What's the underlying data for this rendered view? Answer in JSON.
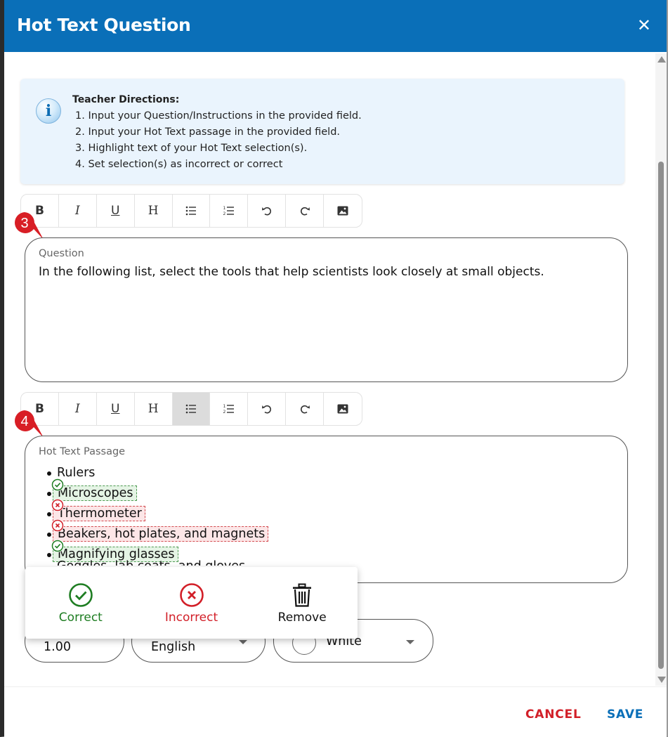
{
  "dialog": {
    "title": "Hot Text Question",
    "close_glyph": "✕"
  },
  "directions": {
    "title": "Teacher Directions:",
    "items": [
      "1. Input your Question/Instructions in the provided field.",
      "2. Input your Hot Text passage in the provided field.",
      "3. Highlight text of your Hot Text selection(s).",
      "4. Set selection(s) as incorrect or correct"
    ]
  },
  "toolbar": {
    "bold": "B",
    "italic": "I",
    "underline": "U",
    "heading": "H"
  },
  "callouts": {
    "question_step": "3",
    "passage_step": "4",
    "color": "#d81e25"
  },
  "question": {
    "label": "Question",
    "text": "In the following list, select the tools that help scientists look closely at small objects."
  },
  "passage": {
    "label": "Hot Text Passage",
    "items": [
      {
        "text": "Rulers",
        "status": "none"
      },
      {
        "text": "Microscopes",
        "status": "correct"
      },
      {
        "text": "Thermometer",
        "status": "incorrect"
      },
      {
        "text": "Beakers, hot plates, and magnets",
        "status": "incorrect"
      },
      {
        "text": "Magnifying glasses",
        "status": "correct"
      }
    ],
    "partial_line": "Goggles, lab coats, and gloves"
  },
  "settings": {
    "points": "1.00",
    "language": "English",
    "color": "White"
  },
  "popup": {
    "correct_label": "Correct",
    "incorrect_label": "Incorrect",
    "remove_label": "Remove"
  },
  "footer": {
    "cancel_label": "CANCEL",
    "save_label": "SAVE"
  },
  "colors": {
    "header": "#0a6fb8",
    "correct": "#1e7d22",
    "incorrect": "#d21f28"
  }
}
